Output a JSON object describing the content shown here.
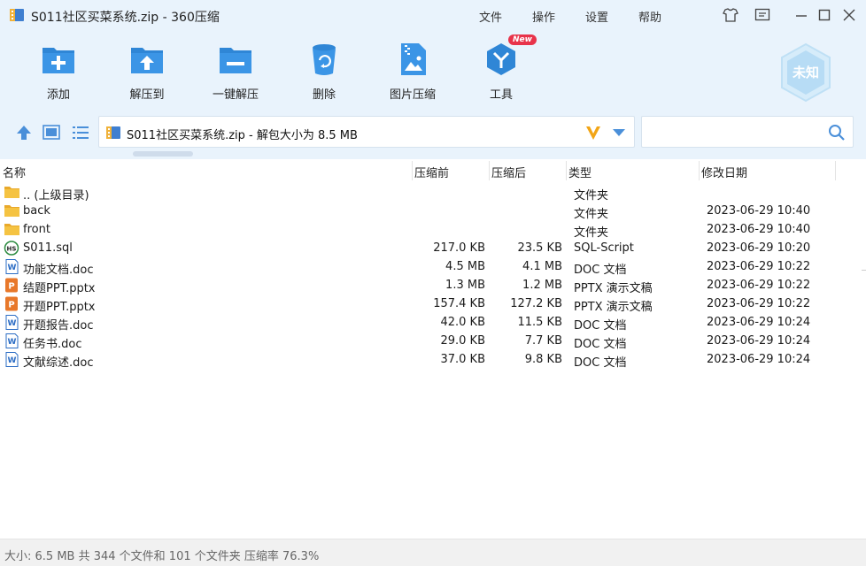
{
  "window": {
    "title": "S011社区买菜系统.zip - 360压缩",
    "menu": [
      "文件",
      "操作",
      "设置",
      "帮助"
    ]
  },
  "toolbar": {
    "items": [
      {
        "label": "添加",
        "icon": "add-folder-icon"
      },
      {
        "label": "解压到",
        "icon": "extract-folder-icon"
      },
      {
        "label": "一键解压",
        "icon": "one-click-extract-icon"
      },
      {
        "label": "删除",
        "icon": "trash-icon"
      },
      {
        "label": "图片压缩",
        "icon": "image-compress-icon"
      },
      {
        "label": "工具",
        "icon": "tools-icon",
        "badge": "New"
      }
    ],
    "status_badge": "未知"
  },
  "address": {
    "path": "S011社区买菜系统.zip - 解包大小为 8.5 MB",
    "search_placeholder": ""
  },
  "columns": {
    "name": "名称",
    "size": "压缩前",
    "compressed": "压缩后",
    "type": "类型",
    "modified": "修改日期"
  },
  "files": [
    {
      "name": ".. (上级目录)",
      "size": "",
      "compressed": "",
      "type": "文件夹",
      "modified": "",
      "icon": "folder-icon"
    },
    {
      "name": "back",
      "size": "",
      "compressed": "",
      "type": "文件夹",
      "modified": "2023-06-29 10:40",
      "icon": "folder-icon"
    },
    {
      "name": "front",
      "size": "",
      "compressed": "",
      "type": "文件夹",
      "modified": "2023-06-29 10:40",
      "icon": "folder-icon"
    },
    {
      "name": "S011.sql",
      "size": "217.0 KB",
      "compressed": "23.5 KB",
      "type": "SQL-Script",
      "modified": "2023-06-29 10:20",
      "icon": "sql-file-icon"
    },
    {
      "name": "功能文档.doc",
      "size": "4.5 MB",
      "compressed": "4.1 MB",
      "type": "DOC 文档",
      "modified": "2023-06-29 10:22",
      "icon": "word-doc-icon"
    },
    {
      "name": "结题PPT.pptx",
      "size": "1.3 MB",
      "compressed": "1.2 MB",
      "type": "PPTX 演示文稿",
      "modified": "2023-06-29 10:22",
      "icon": "pptx-file-icon"
    },
    {
      "name": "开题PPT.pptx",
      "size": "157.4 KB",
      "compressed": "127.2 KB",
      "type": "PPTX 演示文稿",
      "modified": "2023-06-29 10:22",
      "icon": "pptx-file-icon"
    },
    {
      "name": "开题报告.doc",
      "size": "42.0 KB",
      "compressed": "11.5 KB",
      "type": "DOC 文档",
      "modified": "2023-06-29 10:24",
      "icon": "word-doc-icon"
    },
    {
      "name": "任务书.doc",
      "size": "29.0 KB",
      "compressed": "7.7 KB",
      "type": "DOC 文档",
      "modified": "2023-06-29 10:24",
      "icon": "word-doc-icon"
    },
    {
      "name": "文献综述.doc",
      "size": "37.0 KB",
      "compressed": "9.8 KB",
      "type": "DOC 文档",
      "modified": "2023-06-29 10:24",
      "icon": "word-doc-icon"
    }
  ],
  "status": "大小: 6.5 MB 共 344 个文件和 101 个文件夹 压缩率 76.3%",
  "colors": {
    "accent": "#2f86d6",
    "toolbar_bg": "#e9f3fc",
    "folder": "#f5c342",
    "pptx": "#e8782a",
    "doc": "#2b6cc4",
    "new_badge": "#e8334a"
  }
}
